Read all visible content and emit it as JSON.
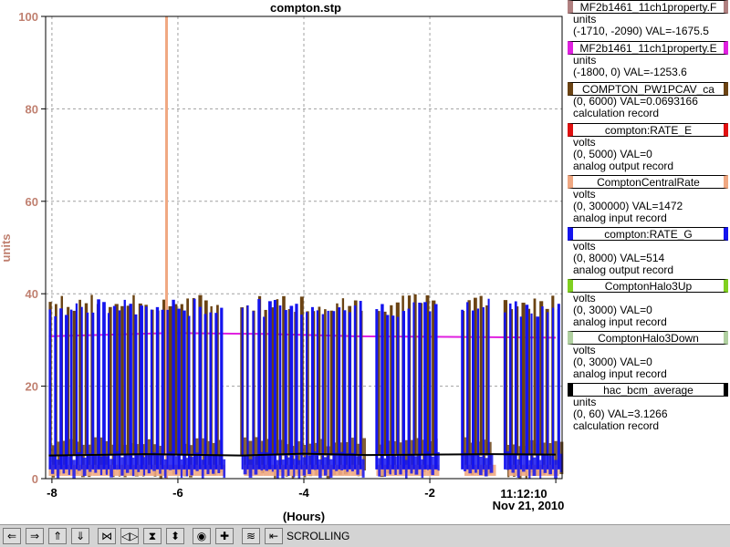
{
  "chart_data": {
    "type": "line",
    "title": "compton.stp",
    "xlabel": "(Hours)",
    "ylabel": "units",
    "xlim": [
      -8.1,
      0.1
    ],
    "ylim": [
      0,
      100
    ],
    "x_ticks": [
      -8,
      -6,
      -4,
      -2
    ],
    "x_tick_labels": [
      "-8",
      "-6",
      "-4",
      "-2"
    ],
    "y_ticks": [
      0,
      20,
      40,
      60,
      80,
      100
    ],
    "y_tick_labels": [
      "0",
      "20",
      "40",
      "60",
      "80",
      "100"
    ],
    "time_label": "11:12:10",
    "date_label": "Nov 21, 2010",
    "grid": true,
    "legend_position": "right",
    "gaps": [
      [
        -5.3,
        -5.05
      ],
      [
        -3.1,
        -2.9
      ],
      [
        -1.9,
        -1.55
      ],
      [
        -1.05,
        -0.85
      ]
    ],
    "series": [
      {
        "name": "MF2b1461_11ch1property.F",
        "color": "#b08080",
        "style": "none",
        "values": []
      },
      {
        "name": "MF2b1461_11ch1property.E",
        "color": "#e020e0",
        "style": "flat",
        "x": [
          -8.05,
          -6.1,
          -4.6,
          -3.2,
          0
        ],
        "values": [
          30.8,
          31.5,
          31.3,
          30.8,
          30.5
        ]
      },
      {
        "name": "COMPTON_PW1PCAV_ca",
        "color": "#6b4313",
        "style": "pulse",
        "low": 5,
        "high": 38
      },
      {
        "name": "compton:RATE_E",
        "color": "#e01010",
        "style": "none",
        "values": []
      },
      {
        "name": "ComptonCentralRate",
        "color": "#f0a882",
        "style": "band",
        "low": 0.6,
        "high": 3,
        "spike_x": -6.18,
        "spike_value": 100
      },
      {
        "name": "compton:RATE_G",
        "color": "#1414ee",
        "style": "pulse",
        "low": 2,
        "high": 37
      },
      {
        "name": "ComptonHalo3Up",
        "color": "#80d020",
        "style": "none",
        "values": []
      },
      {
        "name": "ComptonHalo3Down",
        "color": "#b0d0a0",
        "style": "none",
        "values": []
      },
      {
        "name": "hac_bcm_average",
        "color": "#000000",
        "style": "flat",
        "x": [
          -8.05,
          -6.5,
          -5,
          -4,
          -3,
          -2,
          -1,
          0
        ],
        "values": [
          5.0,
          5.3,
          5.0,
          5.4,
          5.1,
          5.2,
          5.3,
          5.2
        ]
      }
    ]
  },
  "legend": [
    {
      "name": "MF2b1461_11ch1property.F",
      "color": "#b08080",
      "lines": [
        "units",
        "(-1710, -2090) VAL=-1675.5"
      ]
    },
    {
      "name": "MF2b1461_11ch1property.E",
      "color": "#e020e0",
      "lines": [
        "units",
        "(-1800, 0) VAL=-1253.6"
      ]
    },
    {
      "name": "COMPTON_PW1PCAV_ca",
      "color": "#6b4313",
      "lines": [
        "(0, 6000) VAL=0.0693166",
        "calculation record"
      ]
    },
    {
      "name": "compton:RATE_E",
      "color": "#e01010",
      "lines": [
        "volts",
        "(0, 5000) VAL=0",
        "analog output record"
      ]
    },
    {
      "name": "ComptonCentralRate",
      "color": "#f0a882",
      "lines": [
        "volts",
        "(0, 300000) VAL=1472",
        "analog input record"
      ]
    },
    {
      "name": "compton:RATE_G",
      "color": "#1414ee",
      "lines": [
        "volts",
        "(0, 8000) VAL=514",
        "analog output record"
      ]
    },
    {
      "name": "ComptonHalo3Up",
      "color": "#80d020",
      "lines": [
        "volts",
        "(0, 3000) VAL=0",
        "analog input record"
      ]
    },
    {
      "name": "ComptonHalo3Down",
      "color": "#b0d0a0",
      "lines": [
        "volts",
        "(0, 3000) VAL=0",
        "analog input record"
      ]
    },
    {
      "name": "hac_bcm_average",
      "color": "#000000",
      "lines": [
        "units",
        "(0, 60) VAL=3.1266",
        "calculation record"
      ]
    }
  ],
  "toolbar": {
    "status": "SCROLLING",
    "buttons": [
      {
        "name": "scroll-left-button",
        "glyph": "⇐"
      },
      {
        "name": "scroll-right-button",
        "glyph": "⇒"
      },
      {
        "name": "scroll-up-button",
        "glyph": "⇑"
      },
      {
        "name": "scroll-down-button",
        "glyph": "⇓"
      },
      {
        "name": "compress-x-button",
        "glyph": "⋈"
      },
      {
        "name": "expand-x-button",
        "glyph": "◁▷"
      },
      {
        "name": "compress-y-button",
        "glyph": "⧗"
      },
      {
        "name": "expand-y-button",
        "glyph": "⬍"
      },
      {
        "name": "zoom-button",
        "glyph": "◉"
      },
      {
        "name": "add-pv-button",
        "glyph": "✚"
      },
      {
        "name": "auto-scale-button",
        "glyph": "≋"
      },
      {
        "name": "scroll-toggle-button",
        "glyph": "⇤"
      }
    ]
  }
}
